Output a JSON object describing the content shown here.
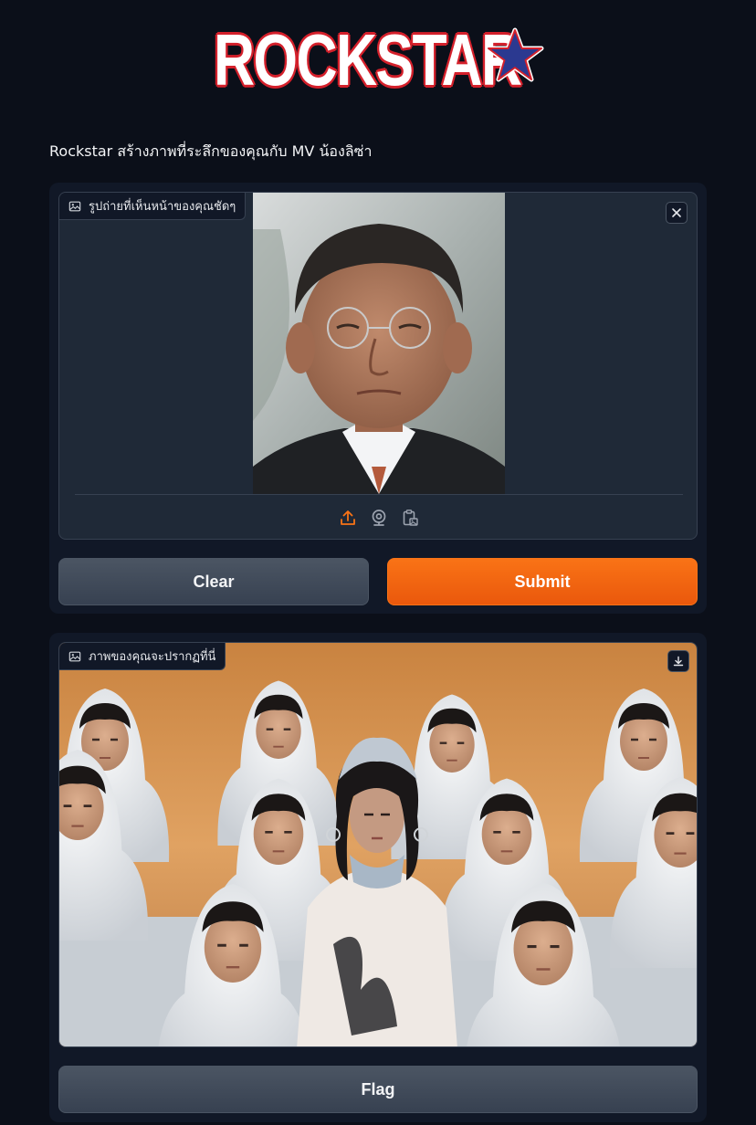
{
  "header": {
    "logo_text": "ROCKSTAR",
    "description": "Rockstar สร้างภาพที่ระลึกของคุณกับ MV น้องลิซ่า"
  },
  "input": {
    "label": "รูปถ่ายที่เห็นหน้าของคุณชัดๆ",
    "label_icon": "image-icon",
    "close_icon": "close-icon",
    "sources": [
      "upload-icon",
      "webcam-icon",
      "clipboard-icon"
    ],
    "active_source": "upload"
  },
  "actions": {
    "clear_label": "Clear",
    "submit_label": "Submit"
  },
  "output": {
    "label": "ภาพของคุณจะปรากฏที่นี่",
    "label_icon": "image-icon",
    "download_icon": "download-icon",
    "flag_label": "Flag"
  },
  "colors": {
    "background": "#0b0f19",
    "panel": "#111827",
    "block": "#1f2937",
    "accent": "#f97316",
    "logo_outline": "#d4202b",
    "star_blue": "#2b3990"
  }
}
